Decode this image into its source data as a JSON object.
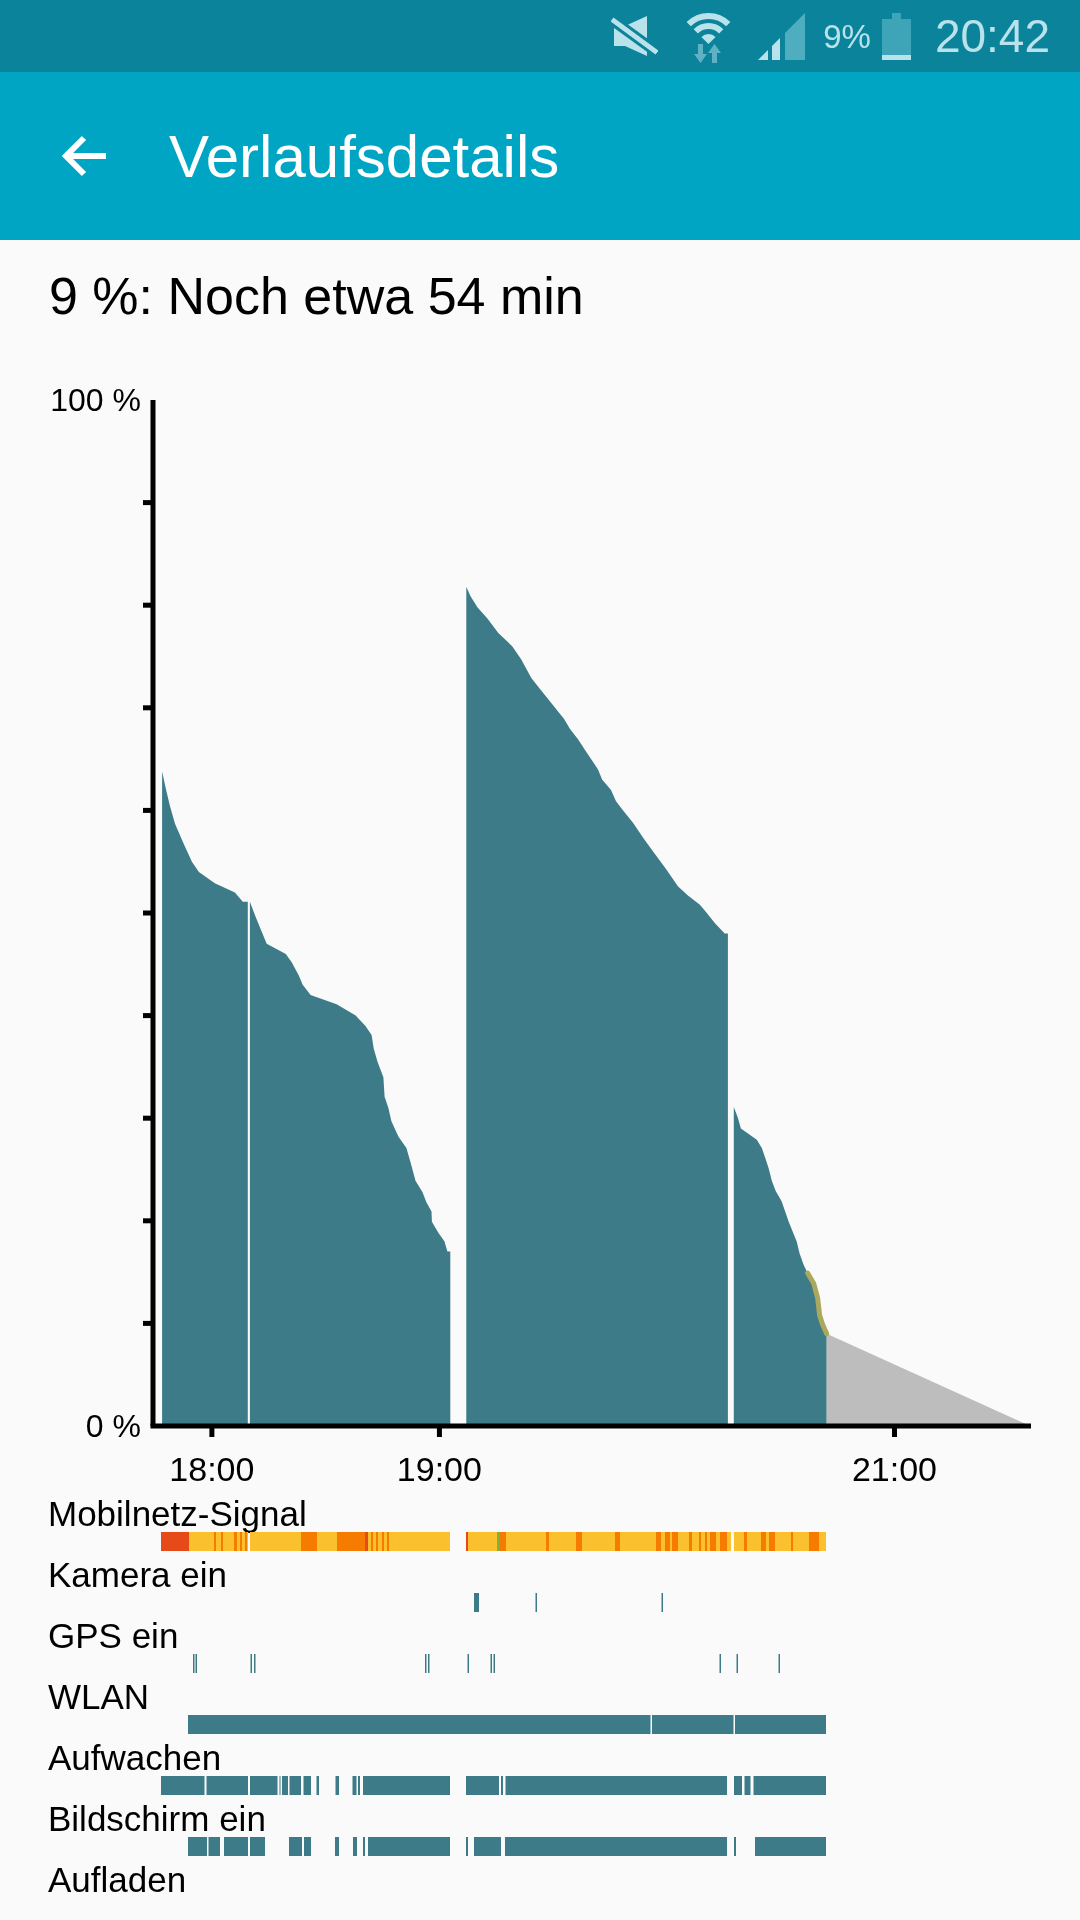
{
  "status_bar": {
    "battery": "9%",
    "time": "20:42"
  },
  "app_bar": {
    "title": "Verlaufsdetails"
  },
  "summary": "9 %: Noch etwa 54 min",
  "battery_chart": {
    "chart_data": {
      "type": "area",
      "x": [
        17.781,
        17.798,
        17.816,
        17.838,
        17.877,
        17.912,
        17.943,
        18.013,
        18.101,
        18.136,
        18.158,
        18.167,
        18.189,
        18.215,
        18.241,
        18.325,
        18.351,
        18.382,
        18.399,
        18.434,
        18.548,
        18.632,
        18.675,
        18.702,
        18.711,
        18.728,
        18.754,
        18.759,
        18.776,
        18.789,
        18.82,
        18.855,
        18.873,
        18.895,
        18.925,
        18.943,
        18.965,
        18.967,
        18.996,
        19.022,
        19.035,
        19.048,
        19.118,
        19.136,
        19.167,
        19.211,
        19.259,
        19.32,
        19.36,
        19.404,
        19.443,
        19.548,
        19.575,
        19.61,
        19.64,
        19.697,
        19.715,
        19.754,
        19.776,
        19.811,
        19.851,
        19.899,
        19.939,
        19.996,
        20.048,
        20.092,
        20.145,
        20.175,
        20.211,
        20.254,
        20.268,
        20.294,
        20.311,
        20.325,
        20.395,
        20.417,
        20.434,
        20.447,
        20.461,
        20.478,
        20.504,
        20.535,
        20.57,
        20.583,
        20.601,
        20.618,
        20.645,
        20.662,
        20.671,
        20.684,
        20.702,
        21.596
      ],
      "xlim": [
        17.75,
        21.6
      ],
      "ylim": [
        0,
        100
      ],
      "xticks": [
        {
          "value": 18,
          "label": "18:00"
        },
        {
          "value": 19,
          "label": "19:00"
        },
        {
          "value": 21,
          "label": "21:00"
        }
      ],
      "yticks": [
        {
          "value": 0,
          "label": "0 %"
        },
        {
          "value": 100,
          "label": "100 %"
        }
      ],
      "series": [
        {
          "color": "#3e7b89",
          "values": [
            63.8,
            62.1,
            60.4,
            58.7,
            56.7,
            55.0,
            54.0,
            52.9,
            52.0,
            51.1,
            51.1,
            null,
            null,
            null,
            null,
            null,
            null,
            null,
            null,
            null,
            null,
            null,
            null,
            null,
            null,
            null,
            null,
            null,
            null,
            null,
            null,
            null,
            null,
            null,
            null,
            null,
            null,
            null,
            null,
            null,
            null,
            null,
            null,
            null,
            null,
            null,
            null,
            null,
            null,
            null,
            null,
            null,
            null,
            null,
            null,
            null,
            null,
            null,
            null,
            null,
            null,
            null,
            null,
            null,
            null,
            null,
            null,
            null,
            null,
            null,
            null,
            null,
            null,
            null,
            null,
            null,
            null,
            null,
            null,
            null,
            null,
            null,
            null,
            null,
            null,
            null,
            null,
            null,
            null,
            null,
            null,
            null
          ]
        },
        {
          "color": "#3e7b89",
          "values": [
            null,
            null,
            null,
            null,
            null,
            null,
            null,
            null,
            null,
            null,
            null,
            51.1,
            49.8,
            48.4,
            47.0,
            46.0,
            45.2,
            43.9,
            43.0,
            42.0,
            41.1,
            40.0,
            39.0,
            38.1,
            36.8,
            35.5,
            34.0,
            32.1,
            31.0,
            29.7,
            28.2,
            27.1,
            25.7,
            23.9,
            22.8,
            21.8,
            20.9,
            19.9,
            18.8,
            18.0,
            17.0,
            17.0,
            null,
            null,
            null,
            null,
            null,
            null,
            null,
            null,
            null,
            null,
            null,
            null,
            null,
            null,
            null,
            null,
            null,
            null,
            null,
            null,
            null,
            null,
            null,
            null,
            null,
            null,
            null,
            null,
            null,
            null,
            null,
            null,
            null,
            null,
            null,
            null,
            null,
            null,
            null,
            null,
            null,
            null,
            null,
            null,
            null,
            null,
            null,
            null,
            null,
            null
          ]
        },
        {
          "color": "#3e7b89",
          "values": [
            null,
            null,
            null,
            null,
            null,
            null,
            null,
            null,
            null,
            null,
            null,
            null,
            null,
            null,
            null,
            null,
            null,
            null,
            null,
            null,
            null,
            null,
            null,
            null,
            null,
            null,
            null,
            null,
            null,
            null,
            null,
            null,
            null,
            null,
            null,
            null,
            null,
            null,
            null,
            null,
            null,
            null,
            81.8,
            80.9,
            79.8,
            78.7,
            77.3,
            76.0,
            74.7,
            72.9,
            71.8,
            68.9,
            67.9,
            66.9,
            65.9,
            64.0,
            63.0,
            62.0,
            60.9,
            59.9,
            58.8,
            57.2,
            56.0,
            54.3,
            52.6,
            51.7,
            50.8,
            50.0,
            49.0,
            48.0,
            48.0,
            null,
            null,
            null,
            null,
            null,
            null,
            null,
            null,
            null,
            null,
            null,
            null,
            null,
            null,
            null,
            null,
            null,
            null,
            null,
            null,
            null
          ]
        },
        {
          "color": "#3e7b89",
          "values": [
            null,
            null,
            null,
            null,
            null,
            null,
            null,
            null,
            null,
            null,
            null,
            null,
            null,
            null,
            null,
            null,
            null,
            null,
            null,
            null,
            null,
            null,
            null,
            null,
            null,
            null,
            null,
            null,
            null,
            null,
            null,
            null,
            null,
            null,
            null,
            null,
            null,
            null,
            null,
            null,
            null,
            null,
            null,
            null,
            null,
            null,
            null,
            null,
            null,
            null,
            null,
            null,
            null,
            null,
            null,
            null,
            null,
            null,
            null,
            null,
            null,
            null,
            null,
            null,
            null,
            null,
            null,
            null,
            null,
            null,
            null,
            31.1,
            30.1,
            29.0,
            27.9,
            27.1,
            26.0,
            25.1,
            23.9,
            22.9,
            21.9,
            19.9,
            18.0,
            16.8,
            15.7,
            14.9,
            13.9,
            12.5,
            10.8,
            9.9,
            9.0,
            null
          ]
        },
        {
          "color": "#bdbdbd",
          "values": [
            null,
            null,
            null,
            null,
            null,
            null,
            null,
            null,
            null,
            null,
            null,
            null,
            null,
            null,
            null,
            null,
            null,
            null,
            null,
            null,
            null,
            null,
            null,
            null,
            null,
            null,
            null,
            null,
            null,
            null,
            null,
            null,
            null,
            null,
            null,
            null,
            null,
            null,
            null,
            null,
            null,
            null,
            null,
            null,
            null,
            null,
            null,
            null,
            null,
            null,
            null,
            null,
            null,
            null,
            null,
            null,
            null,
            null,
            null,
            null,
            null,
            null,
            null,
            null,
            null,
            null,
            null,
            null,
            null,
            null,
            null,
            null,
            null,
            null,
            null,
            null,
            null,
            null,
            null,
            null,
            null,
            null,
            null,
            null,
            null,
            null,
            null,
            null,
            null,
            null,
            9.0,
            0
          ]
        }
      ]
    }
  },
  "timelines": [
    {
      "label": "Mobilnetz-Signal",
      "kind": "signal"
    },
    {
      "label": "Kamera ein",
      "kind": "camera"
    },
    {
      "label": "GPS ein",
      "kind": "gps"
    },
    {
      "label": "WLAN",
      "kind": "wifi"
    },
    {
      "label": "Aufwachen",
      "kind": "wake"
    },
    {
      "label": "Bildschirm ein",
      "kind": "screen"
    },
    {
      "label": "Aufladen",
      "kind": "charging"
    }
  ]
}
